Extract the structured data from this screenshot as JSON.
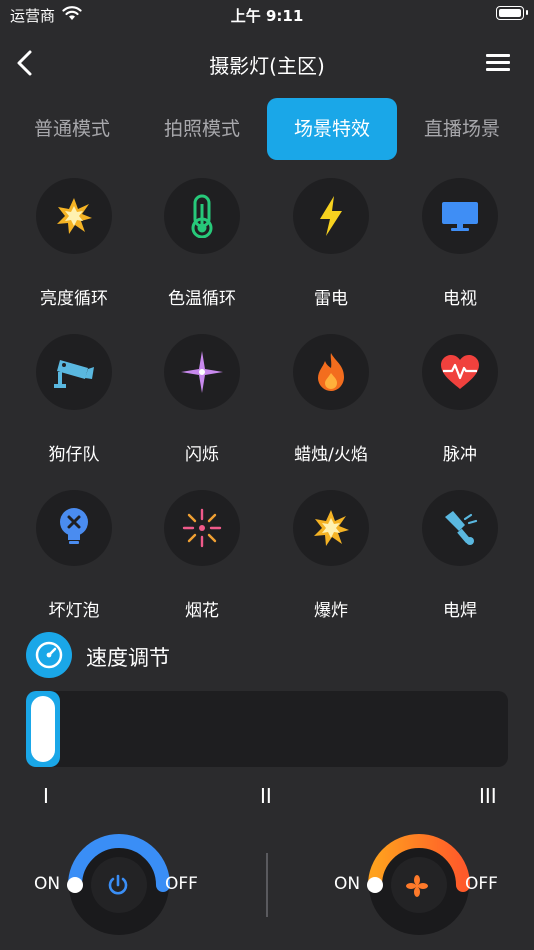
{
  "status_bar": {
    "carrier": "运营商",
    "time": "上午 9:11"
  },
  "nav": {
    "title": "摄影灯(主区)"
  },
  "tabs": [
    {
      "label": "普通模式",
      "active": false
    },
    {
      "label": "拍照模式",
      "active": false
    },
    {
      "label": "场景特效",
      "active": true
    },
    {
      "label": "直播场景",
      "active": false
    }
  ],
  "effects": [
    {
      "label": "亮度循环",
      "icon": "burst-icon"
    },
    {
      "label": "色温循环",
      "icon": "thermometer-icon"
    },
    {
      "label": "雷电",
      "icon": "lightning-icon"
    },
    {
      "label": "电视",
      "icon": "tv-icon"
    },
    {
      "label": "狗仔队",
      "icon": "camera-icon"
    },
    {
      "label": "闪烁",
      "icon": "sparkle-icon"
    },
    {
      "label": "蜡烛/火焰",
      "icon": "flame-icon"
    },
    {
      "label": "脉冲",
      "icon": "heartbeat-icon"
    },
    {
      "label": "坏灯泡",
      "icon": "broken-bulb-icon"
    },
    {
      "label": "烟花",
      "icon": "fireworks-icon"
    },
    {
      "label": "爆炸",
      "icon": "explosion-icon"
    },
    {
      "label": "电焊",
      "icon": "welding-icon"
    }
  ],
  "speed": {
    "title": "速度调节",
    "value_fraction": 0.0,
    "ticks": [
      "I",
      "II",
      "III"
    ]
  },
  "power_control": {
    "on_label": "ON",
    "off_label": "OFF",
    "color": "#3a8ef6"
  },
  "fan_control": {
    "on_label": "ON",
    "off_label": "OFF",
    "color": "#ff7a2a"
  },
  "colors": {
    "accent": "#1aa7e8",
    "background": "#2b2b2d"
  }
}
